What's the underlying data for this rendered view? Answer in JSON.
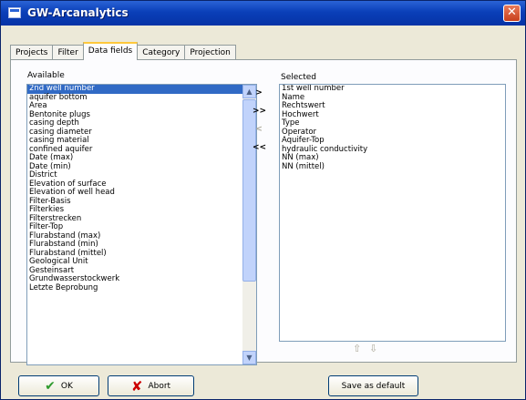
{
  "window": {
    "title": "GW-Arcanalytics"
  },
  "tabs": [
    {
      "label": "Projects",
      "active": false
    },
    {
      "label": "Filter",
      "active": false
    },
    {
      "label": "Data fields",
      "active": true
    },
    {
      "label": "Category",
      "active": false
    },
    {
      "label": "Projection",
      "active": false
    }
  ],
  "available": {
    "label": "Available",
    "selected_item": "2nd well number",
    "items": [
      "2nd well number",
      "aquifer bottom",
      "Area",
      "Bentonite plugs",
      "casing depth",
      "casing diameter",
      "casing material",
      "confined aquifer",
      "Date (max)",
      "Date (min)",
      "District",
      "Elevation of surface",
      "Elevation of well head",
      "Filter-Basis",
      "Filterkies",
      "Filterstrecken",
      "Filter-Top",
      "Flurabstand (max)",
      "Flurabstand (min)",
      "Flurabstand (mittel)",
      "Geological Unit",
      "Gesteinsart",
      "Grundwasserstockwerk",
      "Letzte Beprobung"
    ]
  },
  "move_buttons": {
    "add": ">",
    "add_all": ">>",
    "remove": "<",
    "remove_all": "<<"
  },
  "selected": {
    "label": "Selected",
    "items": [
      "1st well number",
      "Name",
      "Rechtswert",
      "Hochwert",
      "Type",
      "Operator",
      "Aquifer-Top",
      "hydraulic conductivity",
      "NN (max)",
      "NN (mittel)"
    ]
  },
  "order_icons": [
    "arrow-up-icon",
    "arrow-down-icon"
  ],
  "buttons": {
    "ok": "OK",
    "abort": "Abort",
    "save_default": "Save as default"
  },
  "colors": {
    "titlebar": "#0a3fb8",
    "selection": "#316ac5",
    "active_tab": "#ffc83c",
    "close": "#c8401c"
  }
}
